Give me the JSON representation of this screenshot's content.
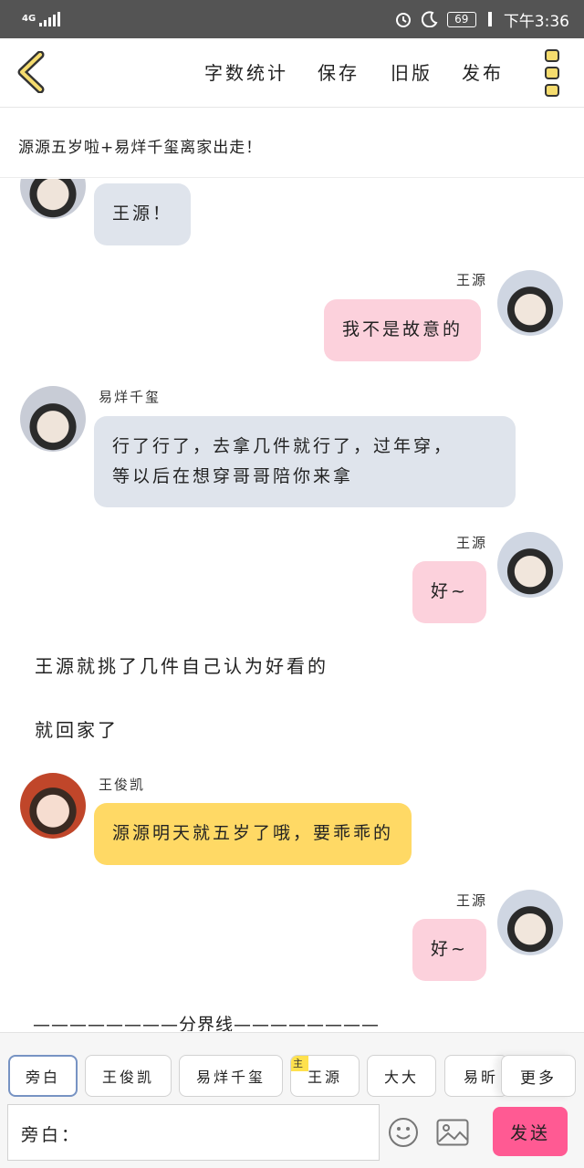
{
  "status_bar": {
    "network": "4G",
    "battery": "69",
    "time": "下午3:36",
    "icons": [
      "signal-icon",
      "alarm-icon",
      "moon-icon",
      "battery-icon",
      "charging-icon"
    ]
  },
  "header": {
    "menu": {
      "word_count": "字数统计",
      "save": "保存",
      "old_version": "旧版",
      "publish": "发布"
    },
    "story_title": "源源五岁啦+易烊千玺离家出走！"
  },
  "messages": {
    "m1": {
      "text": "王源！"
    },
    "m2": {
      "name": "王源",
      "text": "我不是故意的"
    },
    "m3": {
      "name": "易烊千玺",
      "line1": "行了行了，去拿几件就行了，过年穿，",
      "line2": "等以后在想穿哥哥陪你来拿"
    },
    "m4": {
      "name": "王源",
      "text": "好~"
    },
    "n1": {
      "text": "王源就挑了几件自己认为好看的"
    },
    "n2": {
      "text": "就回家了"
    },
    "m5": {
      "name": "王俊凯",
      "text": "源源明天就五岁了哦，要乖乖的"
    },
    "m6": {
      "name": "王源",
      "text": "好~"
    },
    "divider": "————————分界线————————"
  },
  "composer": {
    "roles": [
      "旁白",
      "王俊凯",
      "易烊千玺",
      "王源",
      "大大",
      "易昕"
    ],
    "main_badge": "主",
    "more": "更多",
    "input_label": "旁白：",
    "send": "发送"
  },
  "colors": {
    "pink_bubble": "#fcd1dc",
    "gray_bubble": "#dfe4ec",
    "yellow_bubble": "#ffd965",
    "send_button": "#ff5a93",
    "status_bar": "#545454"
  }
}
